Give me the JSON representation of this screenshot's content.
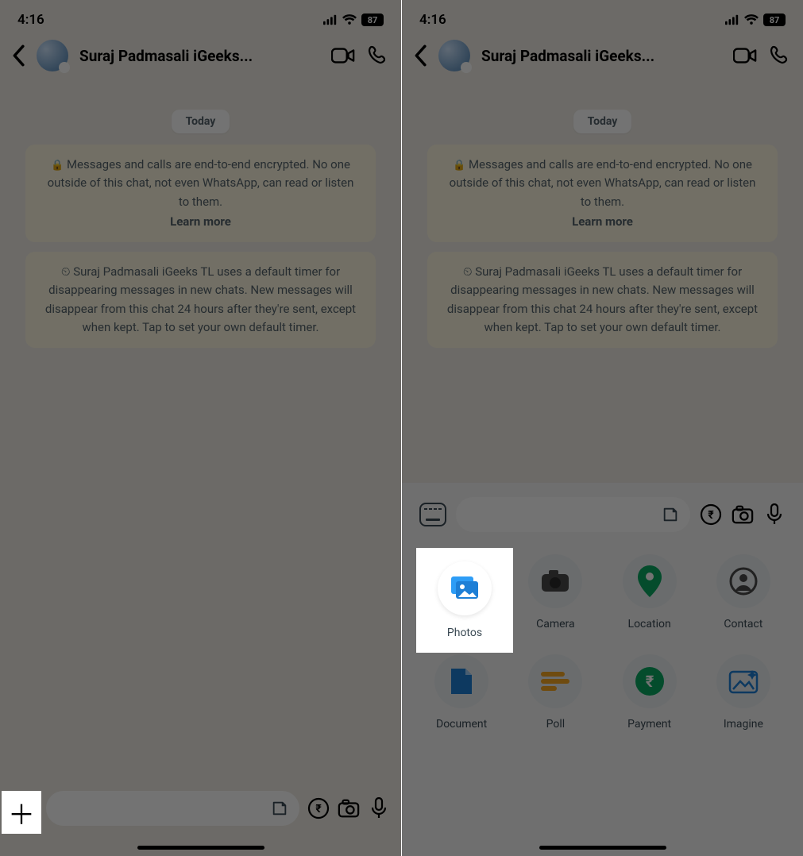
{
  "status": {
    "time": "4:16",
    "battery": "87"
  },
  "header": {
    "contact_name": "Suraj Padmasali iGeeks..."
  },
  "chat": {
    "date_pill": "Today",
    "encryption_text": "Messages and calls are end-to-end encrypted. No one outside of this chat, not even WhatsApp, can read or listen to them.",
    "learn_more": "Learn more",
    "disappearing_text": "Suraj Padmasali iGeeks TL uses a default timer for disappearing messages in new chats. New messages will disappear from this chat 24 hours after they're sent, except when kept. Tap to set your own default timer."
  },
  "attach": {
    "items": [
      {
        "label": "Photos"
      },
      {
        "label": "Camera"
      },
      {
        "label": "Location"
      },
      {
        "label": "Contact"
      },
      {
        "label": "Document"
      },
      {
        "label": "Poll"
      },
      {
        "label": "Payment"
      },
      {
        "label": "Imagine"
      }
    ]
  }
}
